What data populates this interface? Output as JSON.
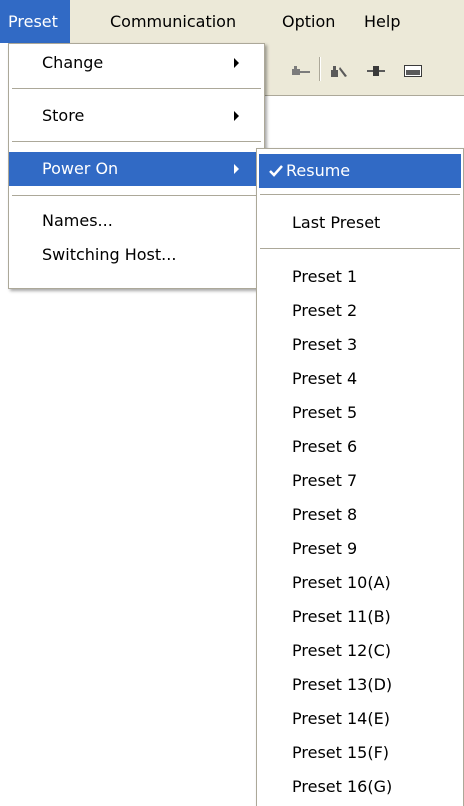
{
  "menubar": {
    "preset": "Preset",
    "communication": "Communication",
    "option": "Option",
    "help": "Help"
  },
  "preset_menu": {
    "change": "Change",
    "store": "Store",
    "power_on": "Power On",
    "names": "Names...",
    "switching_host": "Switching Host..."
  },
  "power_on_menu": {
    "resume": "Resume",
    "last_preset": "Last Preset",
    "presets": [
      "Preset 1",
      "Preset 2",
      "Preset 3",
      "Preset 4",
      "Preset 5",
      "Preset 6",
      "Preset 7",
      "Preset 8",
      "Preset 9",
      "Preset 10(A)",
      "Preset 11(B)",
      "Preset 12(C)",
      "Preset 13(D)",
      "Preset 14(E)",
      "Preset 15(F)",
      "Preset 16(G)"
    ]
  },
  "colors": {
    "highlight": "#316ac5",
    "menubar_bg": "#ece9d8",
    "border": "#aca899"
  },
  "icons": [
    "submenu-arrow-icon",
    "checkmark-icon",
    "toolbar-connect-icon",
    "toolbar-tool-icon",
    "toolbar-slider-icon",
    "toolbar-window-icon"
  ]
}
